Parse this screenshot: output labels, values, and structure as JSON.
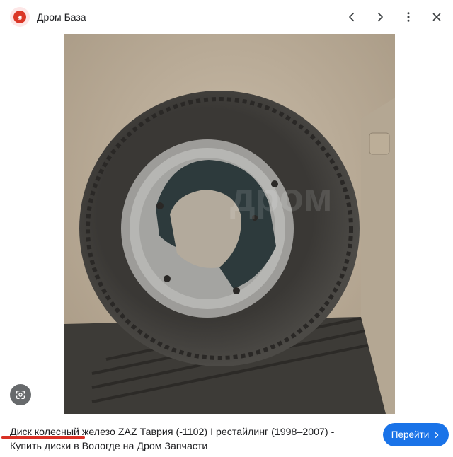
{
  "header": {
    "site_name": "Дром База",
    "logo_icon": "drom-logo-icon",
    "prev_icon": "chevron-left-icon",
    "next_icon": "chevron-right-icon",
    "more_icon": "more-vert-icon",
    "close_icon": "close-icon"
  },
  "image": {
    "watermark": "дром",
    "lens_icon": "google-lens-icon"
  },
  "caption": {
    "highlight": "Диск колесный",
    "rest_line1": " железо ZAZ Таврия (-1102) I рестайлинг (1998–2007) -",
    "line2": "Купить диски в Вологде на Дром Запчасти"
  },
  "action": {
    "visit_label": "Перейти",
    "visit_icon": "chevron-right-icon"
  },
  "colors": {
    "accent": "#1a73e8",
    "underline": "#d93025",
    "logo": "#db3727"
  }
}
